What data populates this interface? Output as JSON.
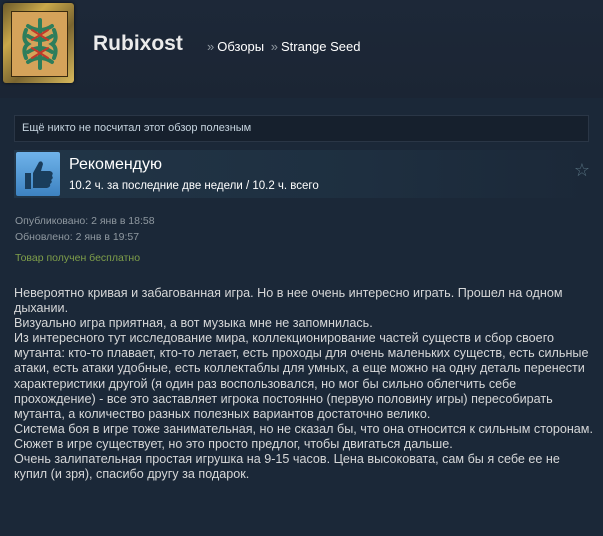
{
  "profile": {
    "name": "Rubixost",
    "breadcrumb": [
      {
        "label": "Обзоры"
      },
      {
        "label": "Strange Seed"
      }
    ],
    "separator": "»"
  },
  "helpful": {
    "text": "Ещё никто не посчитал этот обзор полезным"
  },
  "recommendation": {
    "title": "Рекомендую",
    "hours": "10.2 ч. за последние две недели / 10.2 ч. всего"
  },
  "dates": {
    "posted": "Опубликовано: 2 янв в 18:58",
    "updated": "Обновлено: 2 янв в 19:57",
    "free": "Товар получен бесплатно"
  },
  "review": {
    "paragraphs": [
      "Невероятно кривая и забагованная игра. Но в нее очень интересно играть. Прошел на одном дыхании.",
      "Визуально игра приятная, а вот музыка мне не запомнилась.",
      "Из интересного тут исследование мира, коллекционирование частей существ и сбор своего мутанта: кто-то плавает, кто-то летает, есть проходы для очень маленьких существ, есть сильные атаки, есть атаки удобные, есть коллектаблы для умных, а еще можно на одну деталь перенести характеристики другой (я один раз воспользовался, но мог бы сильно облегчить себе прохождение) - все это заставляет игрока постоянно (первую половину игры) пересобирать мутанта, а количество разных полезных вариантов достаточно велико.",
      "Система боя в игре тоже занимательная, но не сказал бы, что она относится к сильным сторонам.",
      "Сюжет в игре существует, но это просто предлог, чтобы двигаться дальше.",
      "Очень залипательная простая игрушка на 9-15 часов. Цена высоковата, сам бы я себе ее не купил (и зря), спасибо другу за подарок."
    ]
  },
  "colors": {
    "background": "#1b2838",
    "free_text": "#7f9f4a",
    "thumb": "#4d96d6"
  }
}
